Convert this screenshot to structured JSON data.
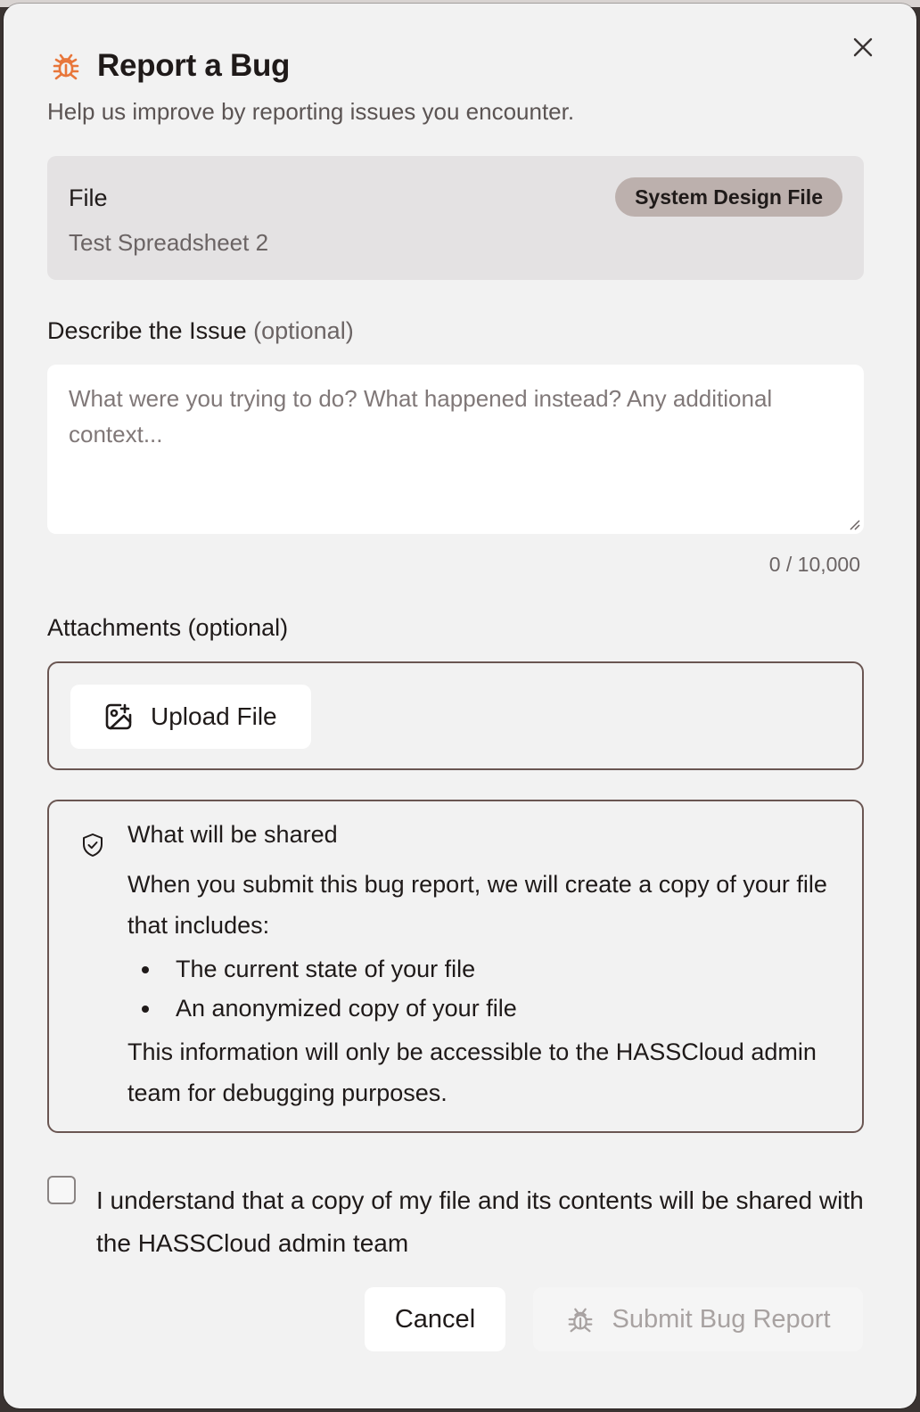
{
  "dialog": {
    "title": "Report a Bug",
    "subtitle": "Help us improve by reporting issues you encounter.",
    "close_icon": "close-icon",
    "header_icon": "bug-icon"
  },
  "file": {
    "label": "File",
    "name": "Test Spreadsheet 2",
    "badge": "System Design File"
  },
  "describe": {
    "label": "Describe the Issue",
    "optional": "(optional)",
    "placeholder": "What were you trying to do? What happened instead? Any additional context...",
    "value": "",
    "char_count": "0 / 10,000"
  },
  "attachments": {
    "label": "Attachments (optional)",
    "upload_label": "Upload File",
    "upload_icon": "image-plus-icon"
  },
  "shared": {
    "icon": "shield-check-icon",
    "title": "What will be shared",
    "intro": "When you submit this bug report, we will create a copy of your file that includes:",
    "items": [
      "The current state of your file",
      "An anonymized copy of your file"
    ],
    "note": "This information will only be accessible to the HASSCloud admin team for debugging purposes."
  },
  "consent": {
    "checked": false,
    "text": "I understand that a copy of my file and its contents will be shared with the HASSCloud admin team"
  },
  "actions": {
    "cancel_label": "Cancel",
    "submit_label": "Submit Bug Report",
    "submit_disabled": true
  },
  "colors": {
    "accent": "#e8763a",
    "border": "#6a5652",
    "badge_bg": "#bcb0ad"
  }
}
